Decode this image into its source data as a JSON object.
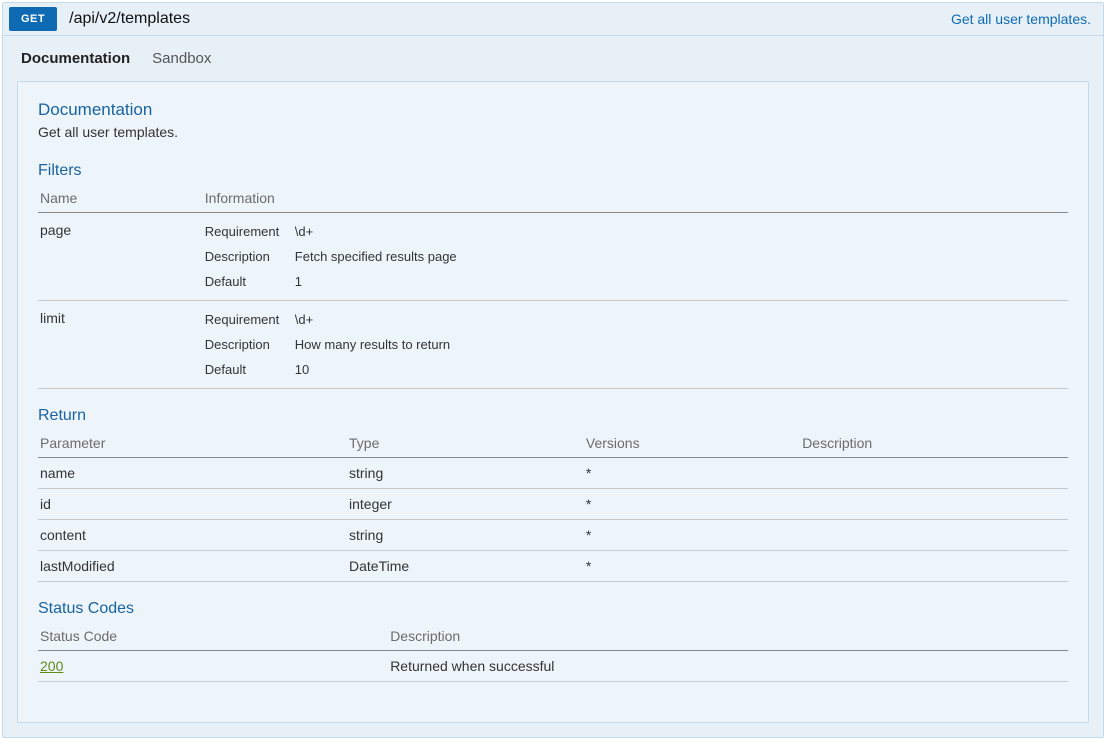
{
  "header": {
    "method": "GET",
    "path": "/api/v2/templates",
    "summary": "Get all user templates."
  },
  "tabs": {
    "documentation": "Documentation",
    "sandbox": "Sandbox"
  },
  "doc": {
    "heading": "Documentation",
    "description": "Get all user templates."
  },
  "filters": {
    "heading": "Filters",
    "columns": {
      "name": "Name",
      "info": "Information"
    },
    "labels": {
      "requirement": "Requirement",
      "description": "Description",
      "default": "Default"
    },
    "rows": [
      {
        "name": "page",
        "requirement": "\\d+",
        "description": "Fetch specified results page",
        "default": "1"
      },
      {
        "name": "limit",
        "requirement": "\\d+",
        "description": "How many results to return",
        "default": "10"
      }
    ]
  },
  "return": {
    "heading": "Return",
    "columns": {
      "parameter": "Parameter",
      "type": "Type",
      "versions": "Versions",
      "description": "Description"
    },
    "rows": [
      {
        "parameter": "name",
        "type": "string",
        "versions": "*",
        "description": ""
      },
      {
        "parameter": "id",
        "type": "integer",
        "versions": "*",
        "description": ""
      },
      {
        "parameter": "content",
        "type": "string",
        "versions": "*",
        "description": ""
      },
      {
        "parameter": "lastModified",
        "type": "DateTime",
        "versions": "*",
        "description": ""
      }
    ]
  },
  "status": {
    "heading": "Status Codes",
    "columns": {
      "code": "Status Code",
      "description": "Description"
    },
    "rows": [
      {
        "code": "200",
        "description": "Returned when successful"
      }
    ]
  }
}
